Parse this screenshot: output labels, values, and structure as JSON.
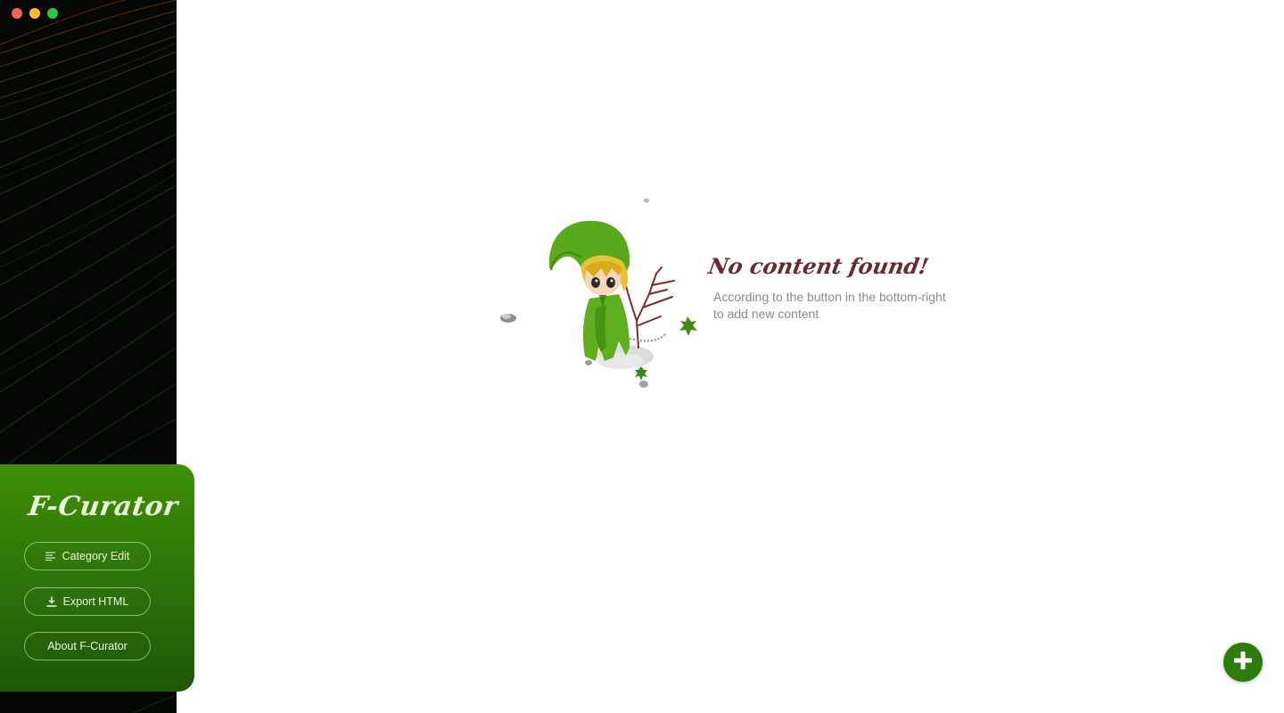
{
  "app": {
    "name": "F-Curator"
  },
  "sidebar": {
    "logo_text": "F-Curator",
    "menu": [
      {
        "label": "Category Edit",
        "icon": "align-left-icon"
      },
      {
        "label": "Export HTML",
        "icon": "download-icon"
      },
      {
        "label": "About F-Curator",
        "icon": ""
      }
    ]
  },
  "empty_state": {
    "title": "No content found!",
    "line1": "According to the button in the bottom-right",
    "line2": "to add new content",
    "illustration": "elf-character-illustration"
  },
  "fab": {
    "icon": "plus-icon"
  },
  "colors": {
    "accent": "#2e7d0c",
    "panel_top": "#3f8f06",
    "panel_bottom": "#1f5708",
    "title": "#6a2a2f",
    "text_muted": "#8a8a8a"
  }
}
